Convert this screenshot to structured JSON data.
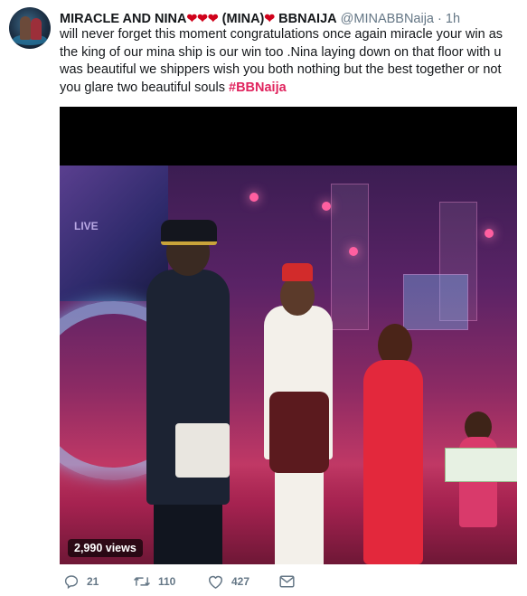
{
  "tweet": {
    "display_name": "MIRACLE AND NINA",
    "name_hearts": "❤❤❤",
    "name_mid": " (MINA)",
    "name_heart2": "❤",
    "name_suffix": " BBNAIJA",
    "handle": "@MINABBNaija",
    "separator": "·",
    "time": "1h",
    "text": "will never forget this moment congratulations  once again miracle  your win as the king of our mina ship is our win too .Nina laying down on that floor with u was beautiful  we shippers wish you both nothing but the best together  or not you glare two beautiful  souls ",
    "hashtag": "#BBNaija"
  },
  "media": {
    "views": "2,990 views",
    "overlay_text": "LIVE"
  },
  "actions": {
    "reply_count": "21",
    "retweet_count": "110",
    "like_count": "427",
    "reply_icon": "reply-icon",
    "retweet_icon": "retweet-icon",
    "like_icon": "heart-icon",
    "dm_icon": "envelope-icon"
  },
  "colors": {
    "hashtag": "#e0245e",
    "heart": "#d0021b",
    "muted": "#657786"
  }
}
